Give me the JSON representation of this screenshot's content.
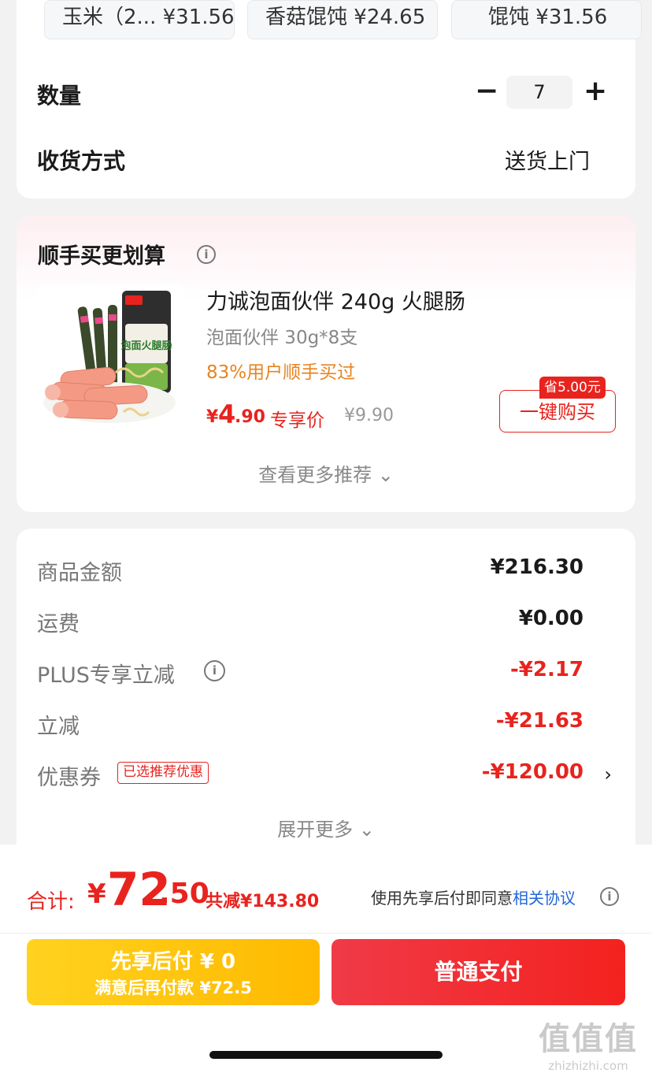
{
  "options": [
    {
      "name": "玉米（2...",
      "price": "¥31.56"
    },
    {
      "name": "香菇馄饨",
      "price": "¥24.65"
    },
    {
      "name": "馄饨",
      "price": "¥31.56"
    }
  ],
  "quantity": {
    "label": "数量",
    "minus": "−",
    "value": "7",
    "plus": "+"
  },
  "delivery": {
    "label": "收货方式",
    "value": "送货上门"
  },
  "recommend": {
    "title": "顺手买更划算",
    "info_icon": "ⓘ",
    "product": {
      "title": "力诚泡面伙伴 240g 火腿肠",
      "spec": "泡面伙伴 30g*8支",
      "bought": "83%用户顺手买过",
      "price_symbol": "¥",
      "price_int": "4",
      "price_dec": ".90",
      "price_tag": "专享价",
      "orig_price": "¥9.90",
      "save_badge": "省5.00元",
      "buy_button": "一键购买",
      "package_text": "泡面火腿肠"
    },
    "see_more": "查看更多推荐 ⌄"
  },
  "summary": {
    "rows": [
      {
        "label": "商品金额",
        "value": "¥216.30"
      },
      {
        "label": "运费",
        "value": "¥0.00"
      },
      {
        "label": "PLUS专享立减",
        "value": "-¥2.17"
      },
      {
        "label": "立减",
        "value": "-¥21.63"
      },
      {
        "label": "优惠券",
        "value": "-¥120.00"
      }
    ],
    "coupon_tag": "已选推荐优惠",
    "chevron": "›",
    "expand_more": "展开更多 ⌄"
  },
  "footer": {
    "total_label": "合计:",
    "total_yen": "¥",
    "total_int": "72",
    "total_dec": ".50",
    "total_save": "共减¥143.80",
    "agree_prefix": "使用先享后付即同意",
    "agree_link": "相关协议",
    "later_line1": "先享后付 ¥ 0",
    "later_line2": "满意后再付款 ¥72.5",
    "pay_button": "普通支付"
  },
  "watermark": {
    "logo": "值值值",
    "url": "zhizhizhi.com"
  },
  "colors": {
    "accent_red": "#e8231e",
    "orange": "#e88422",
    "link_blue": "#2166d9",
    "gold": "#ffc20e"
  }
}
